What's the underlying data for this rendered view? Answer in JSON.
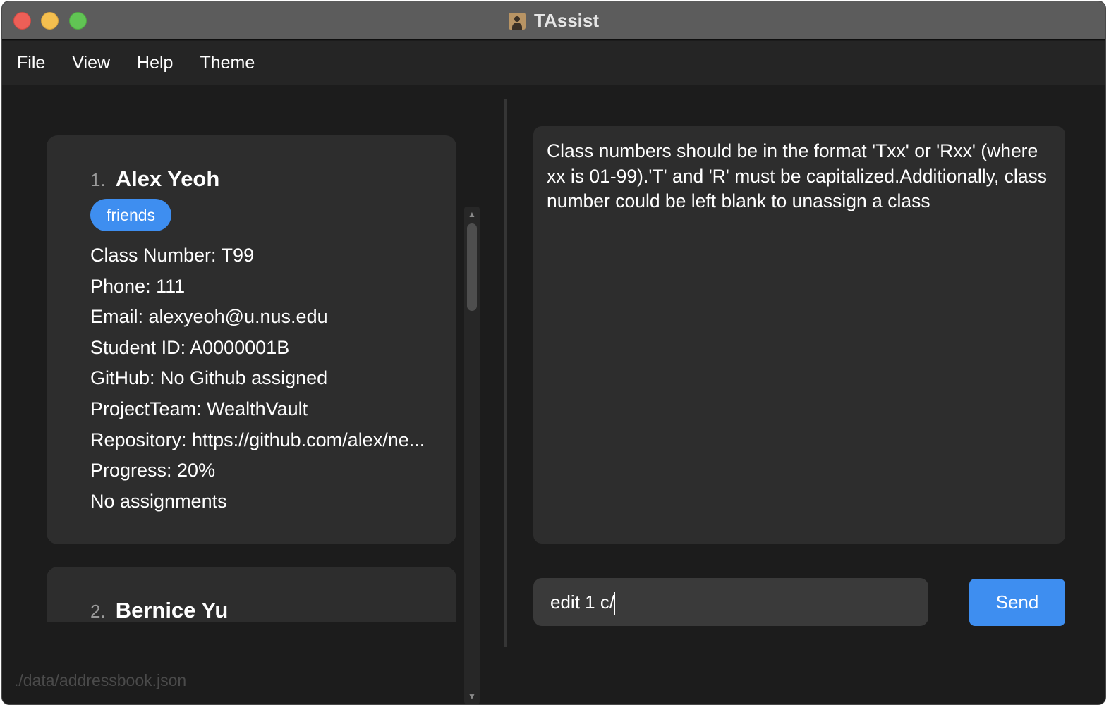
{
  "window": {
    "title": "TAssist",
    "app_icon": "contact-book-icon"
  },
  "menu": {
    "items": [
      "File",
      "View",
      "Help",
      "Theme"
    ]
  },
  "person_list": {
    "cards": [
      {
        "index": "1.",
        "name": "Alex Yeoh",
        "tags": [
          "friends"
        ],
        "fields": [
          "Class Number: T99",
          "Phone: 111",
          "Email: alexyeoh@u.nus.edu",
          "Student ID: A0000001B",
          "GitHub: No Github assigned",
          "ProjectTeam: WealthVault",
          "Repository: https://github.com/alex/ne...",
          "Progress: 20%",
          "No assignments"
        ]
      },
      {
        "index": "2.",
        "name": "Bernice Yu"
      }
    ],
    "scroll_up_icon": "scroll-up-arrow-icon",
    "scroll_down_icon": "scroll-down-arrow-icon"
  },
  "result_display": {
    "text": "Class numbers should be in the format 'Txx' or 'Rxx' (where xx is 01-99).'T' and 'R' must be capitalized.Additionally, class number could be left blank to unassign a class"
  },
  "command_box": {
    "value": "edit 1 c/",
    "send_label": "Send"
  },
  "status_bar": {
    "path": "./data/addressbook.json"
  },
  "colors": {
    "accent": "#3e8ef0",
    "card_bg": "#2d2d2d",
    "window_bg": "#1c1c1c"
  }
}
